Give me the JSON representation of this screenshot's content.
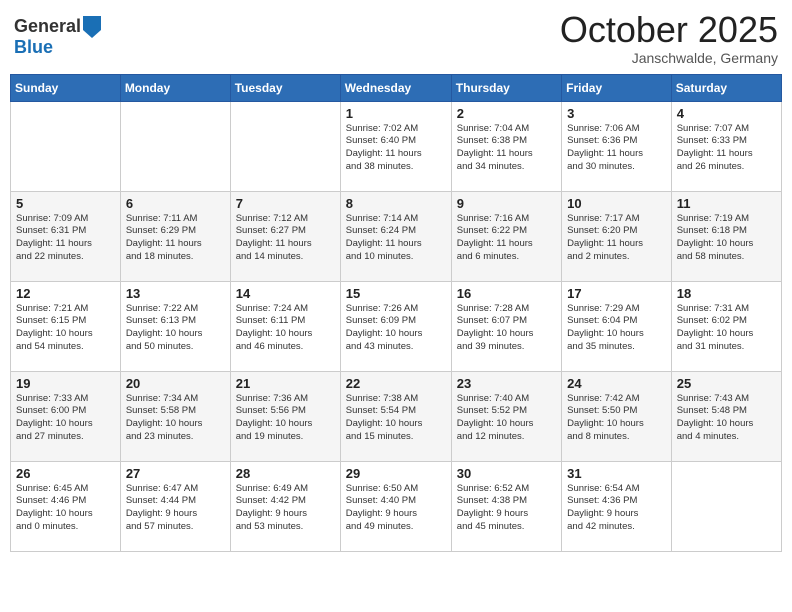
{
  "header": {
    "logo_line1": "General",
    "logo_line2": "Blue",
    "month": "October 2025",
    "location": "Janschwalde, Germany"
  },
  "weekdays": [
    "Sunday",
    "Monday",
    "Tuesday",
    "Wednesday",
    "Thursday",
    "Friday",
    "Saturday"
  ],
  "weeks": [
    [
      {
        "day": "",
        "info": ""
      },
      {
        "day": "",
        "info": ""
      },
      {
        "day": "",
        "info": ""
      },
      {
        "day": "1",
        "info": "Sunrise: 7:02 AM\nSunset: 6:40 PM\nDaylight: 11 hours\nand 38 minutes."
      },
      {
        "day": "2",
        "info": "Sunrise: 7:04 AM\nSunset: 6:38 PM\nDaylight: 11 hours\nand 34 minutes."
      },
      {
        "day": "3",
        "info": "Sunrise: 7:06 AM\nSunset: 6:36 PM\nDaylight: 11 hours\nand 30 minutes."
      },
      {
        "day": "4",
        "info": "Sunrise: 7:07 AM\nSunset: 6:33 PM\nDaylight: 11 hours\nand 26 minutes."
      }
    ],
    [
      {
        "day": "5",
        "info": "Sunrise: 7:09 AM\nSunset: 6:31 PM\nDaylight: 11 hours\nand 22 minutes."
      },
      {
        "day": "6",
        "info": "Sunrise: 7:11 AM\nSunset: 6:29 PM\nDaylight: 11 hours\nand 18 minutes."
      },
      {
        "day": "7",
        "info": "Sunrise: 7:12 AM\nSunset: 6:27 PM\nDaylight: 11 hours\nand 14 minutes."
      },
      {
        "day": "8",
        "info": "Sunrise: 7:14 AM\nSunset: 6:24 PM\nDaylight: 11 hours\nand 10 minutes."
      },
      {
        "day": "9",
        "info": "Sunrise: 7:16 AM\nSunset: 6:22 PM\nDaylight: 11 hours\nand 6 minutes."
      },
      {
        "day": "10",
        "info": "Sunrise: 7:17 AM\nSunset: 6:20 PM\nDaylight: 11 hours\nand 2 minutes."
      },
      {
        "day": "11",
        "info": "Sunrise: 7:19 AM\nSunset: 6:18 PM\nDaylight: 10 hours\nand 58 minutes."
      }
    ],
    [
      {
        "day": "12",
        "info": "Sunrise: 7:21 AM\nSunset: 6:15 PM\nDaylight: 10 hours\nand 54 minutes."
      },
      {
        "day": "13",
        "info": "Sunrise: 7:22 AM\nSunset: 6:13 PM\nDaylight: 10 hours\nand 50 minutes."
      },
      {
        "day": "14",
        "info": "Sunrise: 7:24 AM\nSunset: 6:11 PM\nDaylight: 10 hours\nand 46 minutes."
      },
      {
        "day": "15",
        "info": "Sunrise: 7:26 AM\nSunset: 6:09 PM\nDaylight: 10 hours\nand 43 minutes."
      },
      {
        "day": "16",
        "info": "Sunrise: 7:28 AM\nSunset: 6:07 PM\nDaylight: 10 hours\nand 39 minutes."
      },
      {
        "day": "17",
        "info": "Sunrise: 7:29 AM\nSunset: 6:04 PM\nDaylight: 10 hours\nand 35 minutes."
      },
      {
        "day": "18",
        "info": "Sunrise: 7:31 AM\nSunset: 6:02 PM\nDaylight: 10 hours\nand 31 minutes."
      }
    ],
    [
      {
        "day": "19",
        "info": "Sunrise: 7:33 AM\nSunset: 6:00 PM\nDaylight: 10 hours\nand 27 minutes."
      },
      {
        "day": "20",
        "info": "Sunrise: 7:34 AM\nSunset: 5:58 PM\nDaylight: 10 hours\nand 23 minutes."
      },
      {
        "day": "21",
        "info": "Sunrise: 7:36 AM\nSunset: 5:56 PM\nDaylight: 10 hours\nand 19 minutes."
      },
      {
        "day": "22",
        "info": "Sunrise: 7:38 AM\nSunset: 5:54 PM\nDaylight: 10 hours\nand 15 minutes."
      },
      {
        "day": "23",
        "info": "Sunrise: 7:40 AM\nSunset: 5:52 PM\nDaylight: 10 hours\nand 12 minutes."
      },
      {
        "day": "24",
        "info": "Sunrise: 7:42 AM\nSunset: 5:50 PM\nDaylight: 10 hours\nand 8 minutes."
      },
      {
        "day": "25",
        "info": "Sunrise: 7:43 AM\nSunset: 5:48 PM\nDaylight: 10 hours\nand 4 minutes."
      }
    ],
    [
      {
        "day": "26",
        "info": "Sunrise: 6:45 AM\nSunset: 4:46 PM\nDaylight: 10 hours\nand 0 minutes."
      },
      {
        "day": "27",
        "info": "Sunrise: 6:47 AM\nSunset: 4:44 PM\nDaylight: 9 hours\nand 57 minutes."
      },
      {
        "day": "28",
        "info": "Sunrise: 6:49 AM\nSunset: 4:42 PM\nDaylight: 9 hours\nand 53 minutes."
      },
      {
        "day": "29",
        "info": "Sunrise: 6:50 AM\nSunset: 4:40 PM\nDaylight: 9 hours\nand 49 minutes."
      },
      {
        "day": "30",
        "info": "Sunrise: 6:52 AM\nSunset: 4:38 PM\nDaylight: 9 hours\nand 45 minutes."
      },
      {
        "day": "31",
        "info": "Sunrise: 6:54 AM\nSunset: 4:36 PM\nDaylight: 9 hours\nand 42 minutes."
      },
      {
        "day": "",
        "info": ""
      }
    ]
  ]
}
